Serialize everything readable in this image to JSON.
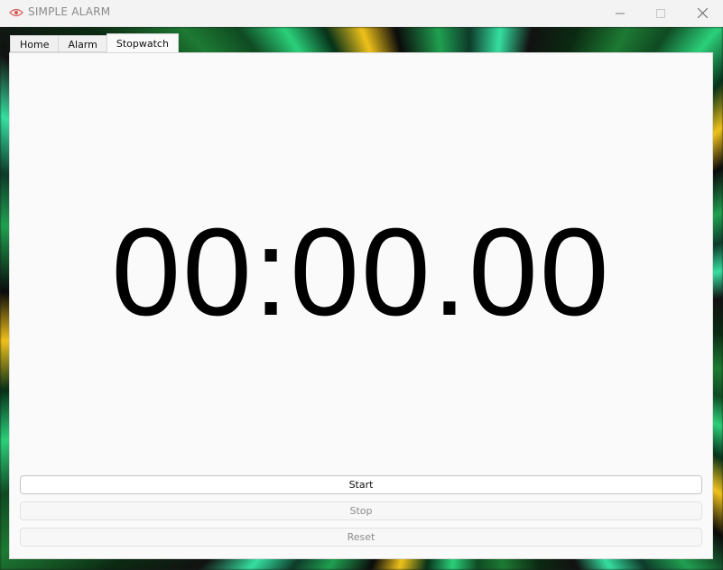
{
  "window": {
    "title": "SIMPLE ALARM",
    "icon": "eye-icon"
  },
  "tabs": [
    {
      "label": "Home",
      "active": false
    },
    {
      "label": "Alarm",
      "active": false
    },
    {
      "label": "Stopwatch",
      "active": true
    }
  ],
  "stopwatch": {
    "display": "00:00.00",
    "buttons": {
      "start": {
        "label": "Start",
        "enabled": true
      },
      "stop": {
        "label": "Stop",
        "enabled": false
      },
      "reset": {
        "label": "Reset",
        "enabled": false
      }
    }
  },
  "colors": {
    "icon_accent": "#d9534f"
  }
}
